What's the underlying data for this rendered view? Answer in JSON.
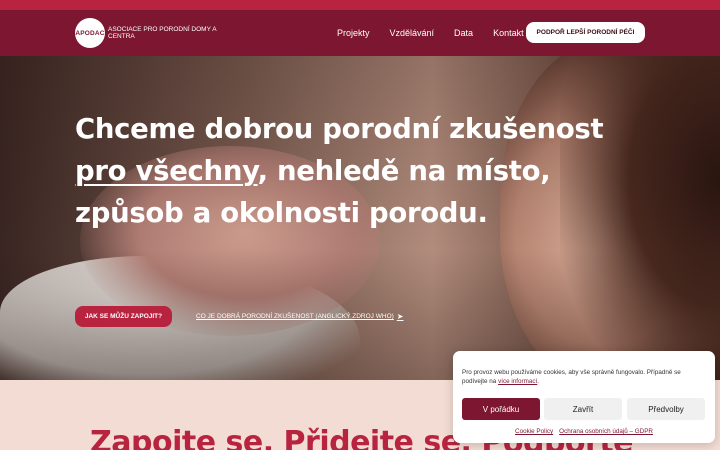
{
  "header": {
    "logo_mark": "APODAC",
    "logo_text": "Asociace pro porodní domy a centra",
    "nav": [
      "Projekty",
      "Vzdělávání",
      "Data",
      "Kontakt"
    ],
    "cta": "PODPOŘ LEPŠÍ PORODNÍ PÉČI"
  },
  "hero": {
    "headline_part1": "Chceme dobrou porodní zkušenost",
    "headline_link": " pro všechny",
    "headline_part2": ", nehledě na místo, způsob a okolnosti porodu.",
    "cta": "JAK SE MŮŽU ZAPOJIT?",
    "who_link": "CO JE DOBRÁ PORODNÍ ZKUŠENOST (ANGLICKÝ ZDROJ WHO)",
    "who_link_icon": "send-icon"
  },
  "section2": {
    "title": "Zapojte se. Přidejte se. Podpořte"
  },
  "cookie_banner": {
    "text": "Pro provoz webu používáme cookies, aby vše správně fungovalo. Případně se podívejte na ",
    "text_link": "více informací",
    "text_end": ".",
    "accept": "V pořádku",
    "deny": "Zavřít",
    "preferences": "Předvolby",
    "links": [
      "Cookie Policy",
      "Ochrana osobních údajů – GDPR"
    ]
  },
  "colors": {
    "brand": "#7d1630",
    "accent": "#b8243f",
    "section_bg": "#f2dcd3"
  }
}
